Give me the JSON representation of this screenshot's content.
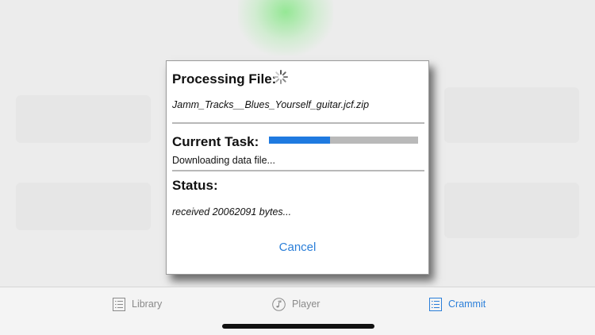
{
  "dialog": {
    "processing_label": "Processing File:",
    "file_name": "Jamm_Tracks__Blues_Yourself_guitar.jcf.zip",
    "current_task_label": "Current Task:",
    "progress": 0.41,
    "task_detail": "Downloading data file...",
    "status_label": "Status:",
    "status_detail": "received 20062091 bytes...",
    "cancel_label": "Cancel"
  },
  "tabbar": {
    "tabs": [
      {
        "label": "Library",
        "icon": "list-icon",
        "active": false
      },
      {
        "label": "Player",
        "icon": "music-note-icon",
        "active": false
      },
      {
        "label": "Crammit",
        "icon": "list-icon",
        "active": true
      }
    ]
  },
  "colors": {
    "accent": "#2b7fd9",
    "progress_fill": "#1f7ae0",
    "progress_track": "#b9b9b9"
  }
}
